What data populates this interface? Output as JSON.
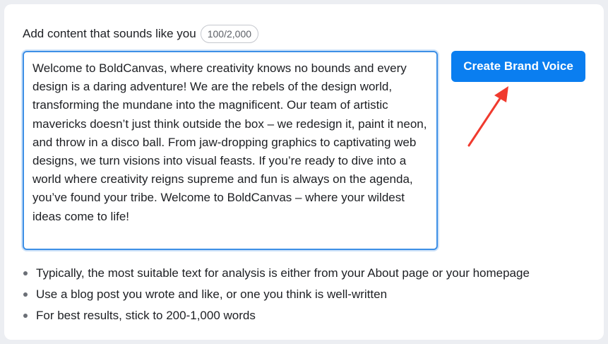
{
  "header": {
    "label": "Add content that sounds like you",
    "counter": "100/2,000"
  },
  "editor": {
    "value": "Welcome to BoldCanvas, where creativity knows no bounds and every design is a daring adventure! We are the rebels of the design world, transforming the mundane into the magnificent. Our team of artistic mavericks doesn’t just think outside the box – we redesign it, paint it neon, and throw in a disco ball. From jaw-dropping graphics to captivating web designs, we turn visions into visual feasts. If you’re ready to dive into a world where creativity reigns supreme and fun is always on the agenda, you’ve found your tribe. Welcome to BoldCanvas – where your wildest ideas come to life!"
  },
  "actions": {
    "create_label": "Create Brand Voice",
    "accent_color": "#0a7ef0",
    "arrow_color": "#f03a2e"
  },
  "tips": [
    "Typically, the most suitable text for analysis is either from your About page or your homepage",
    "Use a blog post you wrote and like, or one you think is well-written",
    "For best results, stick to 200-1,000 words"
  ]
}
